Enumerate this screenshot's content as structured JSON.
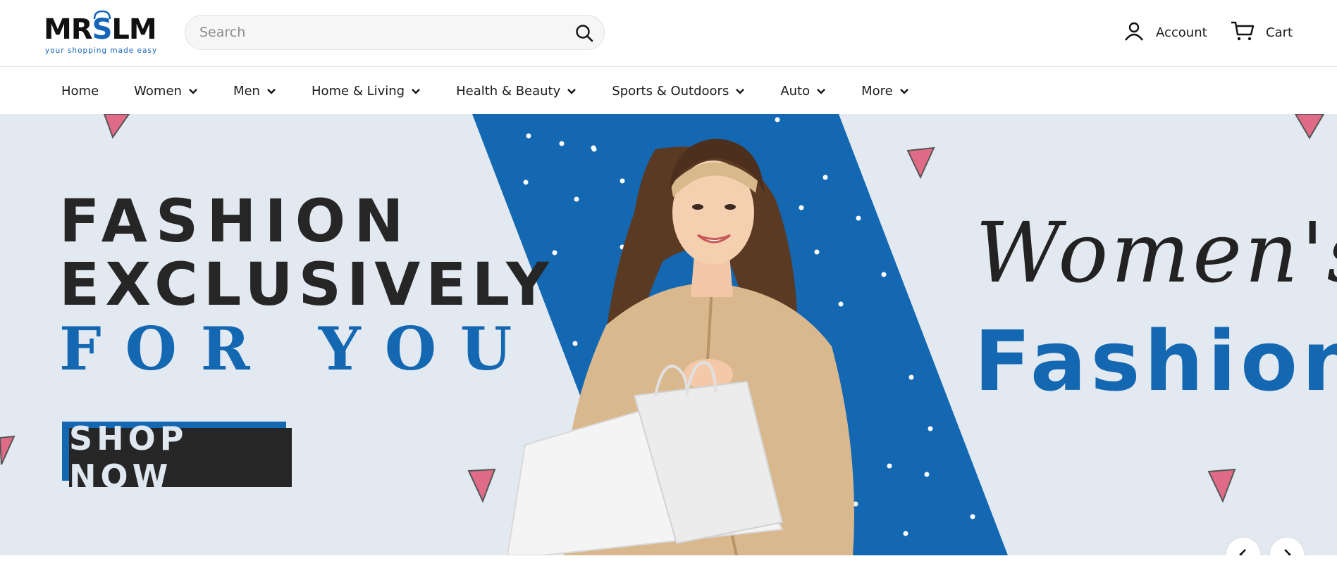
{
  "header": {
    "logo": {
      "text_main": "MRSLM",
      "tagline": "your shopping made easy",
      "brand_color": "#1565b8"
    },
    "search": {
      "placeholder": "Search",
      "value": "",
      "icon": "search-icon"
    },
    "account": {
      "label": "Account",
      "icon": "user-icon"
    },
    "cart": {
      "label": "Cart",
      "icon": "cart-icon"
    }
  },
  "nav": {
    "items": [
      {
        "label": "Home",
        "has_dropdown": false
      },
      {
        "label": "Women",
        "has_dropdown": true
      },
      {
        "label": "Men",
        "has_dropdown": true
      },
      {
        "label": "Home & Living",
        "has_dropdown": true
      },
      {
        "label": "Health & Beauty",
        "has_dropdown": true
      },
      {
        "label": "Sports & Outdoors",
        "has_dropdown": true
      },
      {
        "label": "Auto",
        "has_dropdown": true
      },
      {
        "label": "More",
        "has_dropdown": true
      }
    ]
  },
  "hero": {
    "headline_line1": "FASHION",
    "headline_line2": "EXCLUSIVELY",
    "headline_line3": "FOR YOU",
    "cta_label": "SHOP NOW",
    "script_text": "Women's",
    "category_text": "Fashion",
    "colors": {
      "accent": "#1468b2",
      "background": "#e3e9f1",
      "dark": "#262626",
      "triangle": "#e06b86"
    },
    "controls": {
      "prev_icon": "chevron-left-icon",
      "next_icon": "chevron-right-icon"
    }
  }
}
